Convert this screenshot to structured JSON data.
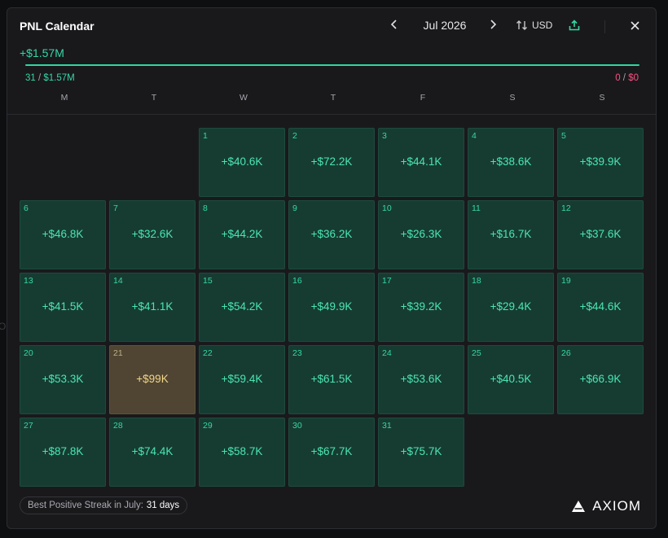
{
  "header": {
    "title": "PNL Calendar",
    "month": "Jul 2026",
    "currency": "USD",
    "prev_icon": "chevron-left-icon",
    "next_icon": "chevron-right-icon",
    "sort_icon": "swap-vertical-icon",
    "share_icon": "upload-icon",
    "close_icon": "close-icon"
  },
  "summary": {
    "total": "+$1.57M",
    "positive_days": "31",
    "positive_sep": " / ",
    "positive_amount": "$1.57M",
    "negative_days": "0",
    "negative_sep": " / ",
    "negative_amount": "$0",
    "positive_share": 1.0
  },
  "weekdays": [
    "M",
    "T",
    "W",
    "T",
    "F",
    "S",
    "S"
  ],
  "calendar": {
    "leading_blanks": 2,
    "days": [
      {
        "day": "1",
        "pnl": "+$40.6K"
      },
      {
        "day": "2",
        "pnl": "+$72.2K"
      },
      {
        "day": "3",
        "pnl": "+$44.1K"
      },
      {
        "day": "4",
        "pnl": "+$38.6K"
      },
      {
        "day": "5",
        "pnl": "+$39.9K"
      },
      {
        "day": "6",
        "pnl": "+$46.8K"
      },
      {
        "day": "7",
        "pnl": "+$32.6K"
      },
      {
        "day": "8",
        "pnl": "+$44.2K"
      },
      {
        "day": "9",
        "pnl": "+$36.2K"
      },
      {
        "day": "10",
        "pnl": "+$26.3K"
      },
      {
        "day": "11",
        "pnl": "+$16.7K"
      },
      {
        "day": "12",
        "pnl": "+$37.6K"
      },
      {
        "day": "13",
        "pnl": "+$41.5K"
      },
      {
        "day": "14",
        "pnl": "+$41.1K"
      },
      {
        "day": "15",
        "pnl": "+$54.2K"
      },
      {
        "day": "16",
        "pnl": "+$49.9K"
      },
      {
        "day": "17",
        "pnl": "+$39.2K"
      },
      {
        "day": "18",
        "pnl": "+$29.4K"
      },
      {
        "day": "19",
        "pnl": "+$44.6K"
      },
      {
        "day": "20",
        "pnl": "+$53.3K"
      },
      {
        "day": "21",
        "pnl": "+$99K",
        "best": true
      },
      {
        "day": "22",
        "pnl": "+$59.4K"
      },
      {
        "day": "23",
        "pnl": "+$61.5K"
      },
      {
        "day": "24",
        "pnl": "+$53.6K"
      },
      {
        "day": "25",
        "pnl": "+$40.5K"
      },
      {
        "day": "26",
        "pnl": "+$66.9K"
      },
      {
        "day": "27",
        "pnl": "+$87.8K"
      },
      {
        "day": "28",
        "pnl": "+$74.4K"
      },
      {
        "day": "29",
        "pnl": "+$58.7K"
      },
      {
        "day": "30",
        "pnl": "+$67.7K"
      },
      {
        "day": "31",
        "pnl": "+$75.7K"
      }
    ]
  },
  "footer": {
    "streak_label": "Best Positive Streak in July:",
    "streak_value": "31 days",
    "brand": "AXIOM",
    "brand_icon": "axiom-logo-icon"
  },
  "colors": {
    "positive": "#35d7a4",
    "negative": "#ff4f81",
    "best_day": "#f3d68a"
  }
}
